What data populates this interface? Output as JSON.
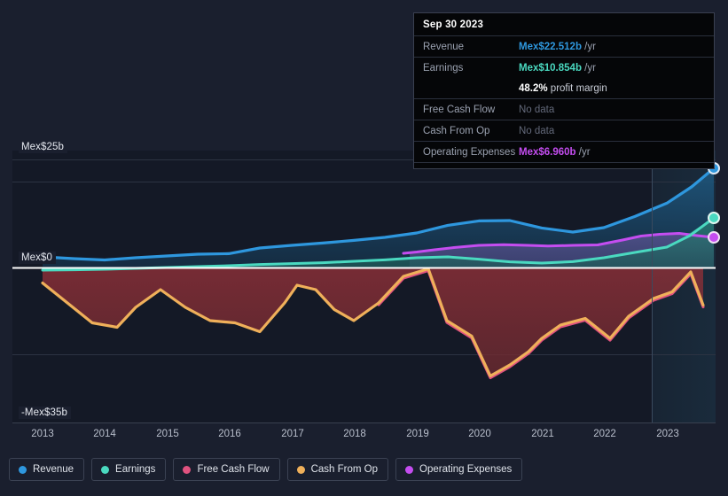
{
  "tooltip": {
    "date": "Sep 30 2023",
    "rows": [
      {
        "label": "Revenue",
        "value": "Mex$22.512b",
        "unit": " /yr",
        "color": "#2e97de",
        "type": "value"
      },
      {
        "label": "Earnings",
        "value": "Mex$10.854b",
        "unit": " /yr",
        "color": "#4ad9c0",
        "type": "value"
      },
      {
        "label": "",
        "value": "48.2%",
        "unit": " profit margin",
        "color": "#ffffff",
        "type": "margin"
      },
      {
        "label": "Free Cash Flow",
        "value": "No data",
        "unit": "",
        "color": "#63697a",
        "type": "nodata"
      },
      {
        "label": "Cash From Op",
        "value": "No data",
        "unit": "",
        "color": "#63697a",
        "type": "nodata"
      },
      {
        "label": "Operating Expenses",
        "value": "Mex$6.960b",
        "unit": " /yr",
        "color": "#c44df0",
        "type": "value"
      }
    ]
  },
  "legend": {
    "items": [
      {
        "label": "Revenue",
        "color": "#2e97de"
      },
      {
        "label": "Earnings",
        "color": "#4ad9c0"
      },
      {
        "label": "Free Cash Flow",
        "color": "#e0527f"
      },
      {
        "label": "Cash From Op",
        "color": "#efb05a"
      },
      {
        "label": "Operating Expenses",
        "color": "#c44df0"
      }
    ]
  },
  "chart_data": {
    "type": "area",
    "title": "",
    "xlabel": "",
    "ylabel": "",
    "currency": "Mex$",
    "units": "billions",
    "ylim": [
      -35,
      25
    ],
    "y_ticks": [
      {
        "value": 25,
        "label": "Mex$25b"
      },
      {
        "value": 0,
        "label": "Mex$0"
      },
      {
        "value": -35,
        "label": "-Mex$35b"
      }
    ],
    "x_ticks": [
      "2013",
      "2014",
      "2015",
      "2016",
      "2017",
      "2018",
      "2019",
      "2020",
      "2021",
      "2022",
      "2023"
    ],
    "grid": true,
    "legend_position": "bottom",
    "forecast_divider_year": 2022.75,
    "series": [
      {
        "name": "Revenue",
        "color": "#2e97de",
        "x": [
          2013.0,
          2013.5,
          2014.0,
          2014.5,
          2015.0,
          2015.5,
          2016.0,
          2016.5,
          2017.0,
          2017.5,
          2018.0,
          2018.5,
          2019.0,
          2019.5,
          2020.0,
          2020.5,
          2021.0,
          2021.5,
          2022.0,
          2022.5,
          2023.0,
          2023.75
        ],
        "values": [
          2.4,
          2.0,
          1.7,
          2.2,
          2.6,
          3.0,
          3.1,
          4.4,
          5.0,
          5.5,
          6.1,
          6.8,
          7.8,
          9.5,
          10.5,
          10.6,
          8.9,
          8.0,
          9.0,
          11.5,
          14.5,
          22.5
        ]
      },
      {
        "name": "Earnings",
        "color": "#4ad9c0",
        "x": [
          2013.0,
          2013.5,
          2014.0,
          2014.5,
          2015.0,
          2015.5,
          2016.0,
          2016.5,
          2017.0,
          2017.5,
          2018.0,
          2018.5,
          2019.0,
          2019.5,
          2020.0,
          2020.5,
          2021.0,
          2021.5,
          2022.0,
          2022.5,
          2023.0,
          2023.75
        ],
        "values": [
          -0.6,
          -0.5,
          -0.4,
          -0.2,
          0.0,
          0.2,
          0.4,
          0.7,
          0.9,
          1.1,
          1.4,
          1.7,
          2.2,
          2.4,
          1.9,
          1.3,
          1.0,
          1.3,
          2.2,
          3.4,
          4.6,
          10.85
        ]
      },
      {
        "name": "Operating Expenses",
        "color": "#c44df0",
        "x": [
          2019.2,
          2019.5,
          2020.0,
          2020.5,
          2021.0,
          2021.5,
          2022.0,
          2022.5,
          2023.0,
          2023.4,
          2023.75
        ],
        "values": [
          3.4,
          3.8,
          4.4,
          5.1,
          5.2,
          4.9,
          5.1,
          5.4,
          6.6,
          7.4,
          6.96
        ]
      },
      {
        "name": "Cash From Op",
        "color": "#efb05a",
        "x": [
          2013.0,
          2013.4,
          2013.8,
          2014.2,
          2014.5,
          2014.9,
          2015.3,
          2015.7,
          2016.1,
          2016.5,
          2016.9,
          2017.1,
          2017.4,
          2017.7,
          2018.0,
          2018.4,
          2018.8,
          2019.2,
          2019.5,
          2019.9,
          2020.2,
          2020.5,
          2020.8,
          2021.0,
          2021.3,
          2021.7,
          2022.1,
          2022.4,
          2022.8,
          2023.1,
          2023.4,
          2023.6
        ],
        "values": [
          -3.5,
          -8.0,
          -12.5,
          -13.5,
          -9.0,
          -5.0,
          -9.0,
          -12.0,
          -12.5,
          -14.5,
          -8.0,
          -4.0,
          -5.0,
          -9.5,
          -12.0,
          -8.0,
          -2.0,
          -0.3,
          -12.0,
          -15.5,
          -24.5,
          -22.0,
          -19.0,
          -16.0,
          -13.0,
          -11.5,
          -16.0,
          -11.0,
          -7.0,
          -5.5,
          -1.0,
          -8.5
        ]
      },
      {
        "name": "Free Cash Flow",
        "color": "#e0527f",
        "x": [
          2018.4,
          2018.8,
          2019.2,
          2019.5,
          2019.9,
          2020.2,
          2020.5,
          2020.8,
          2021.0,
          2021.3,
          2021.7,
          2022.1,
          2022.4,
          2022.8,
          2023.1,
          2023.4,
          2023.6
        ],
        "values": [
          -8.4,
          -2.4,
          -0.7,
          -12.4,
          -15.9,
          -24.9,
          -22.4,
          -19.4,
          -16.4,
          -13.4,
          -11.9,
          -16.4,
          -11.4,
          -7.4,
          -5.9,
          -1.4,
          -8.9
        ]
      }
    ]
  }
}
